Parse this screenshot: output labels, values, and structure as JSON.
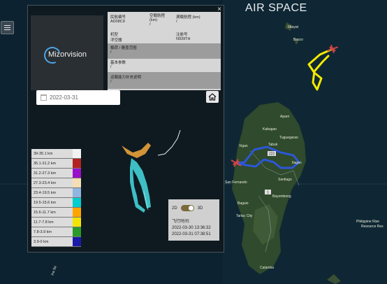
{
  "map": {
    "brand": "AIR SPACE",
    "places": [
      {
        "name": "Itbayat"
      },
      {
        "name": "Basco"
      },
      {
        "name": "Aparri"
      },
      {
        "name": "Kabugao"
      },
      {
        "name": "Tuguegarao"
      },
      {
        "name": "Vigan"
      },
      {
        "name": "Tabuk"
      },
      {
        "name": "Ilagan"
      },
      {
        "name": "Santiago"
      },
      {
        "name": "San Fernando"
      },
      {
        "name": "Baguio"
      },
      {
        "name": "Bayombong"
      },
      {
        "name": "Tarlac City"
      },
      {
        "name": "Philippine Rise"
      },
      {
        "name": "Resource Res"
      },
      {
        "name": "ina Se"
      },
      {
        "name": "Calamba"
      }
    ],
    "road_labels": [
      "222",
      "1"
    ]
  },
  "panel": {
    "close": "×",
    "logo_text": "Mizorvision",
    "info": {
      "civil_id_label": "民航编号",
      "civil_id_value": "AD08C9",
      "cap_label": "空载航程",
      "cap_unit": "(km)",
      "cap_value": "/",
      "full_label": "满载航程",
      "full_unit": "(km)",
      "full_value": "/",
      "model_label": "机型",
      "model_value": "浮空器",
      "reg_label": "注册号",
      "reg_value": "N939TH",
      "range_label": "载荷 / 覆盖范围",
      "range_value": "/",
      "basic_label": "基本参数",
      "basic_value": "/",
      "capability_label": "运载能力补充说明",
      "capability_value": "/"
    },
    "date_value": "2022-03-31",
    "legend": [
      {
        "label": "39-35.1 km",
        "color": "#f2f2f2"
      },
      {
        "label": "35.1-31.2 km",
        "color": "#b22222"
      },
      {
        "label": "31.2-27.3 km",
        "color": "#9a0fc9"
      },
      {
        "label": "27.3-23.4 km",
        "color": "#f5deb3"
      },
      {
        "label": "23.4-19.5 km",
        "color": "#8fb6e0"
      },
      {
        "label": "19.5-15.6 km",
        "color": "#00ced1"
      },
      {
        "label": "15.6-11.7 km",
        "color": "#ffa500"
      },
      {
        "label": "11.7-7.8 km",
        "color": "#f5e400"
      },
      {
        "label": "7.8-3.9 km",
        "color": "#2a9a2a"
      },
      {
        "label": "3.9-0 km",
        "color": "#1a1aa8"
      }
    ],
    "mode": {
      "label_2d": "2D",
      "label_3d": "3D",
      "flight_time_label": "飞行时间:",
      "time_start": "2022-03-30 13:36:32",
      "time_end": "2022-03-31 07:38:51"
    }
  },
  "colors": {
    "track_cyan": "#3dbfc4",
    "track_orange": "#e8a23a",
    "route_blue": "#2c57d8",
    "route_yellow": "#f2ea00",
    "marker_red": "#d64545"
  }
}
